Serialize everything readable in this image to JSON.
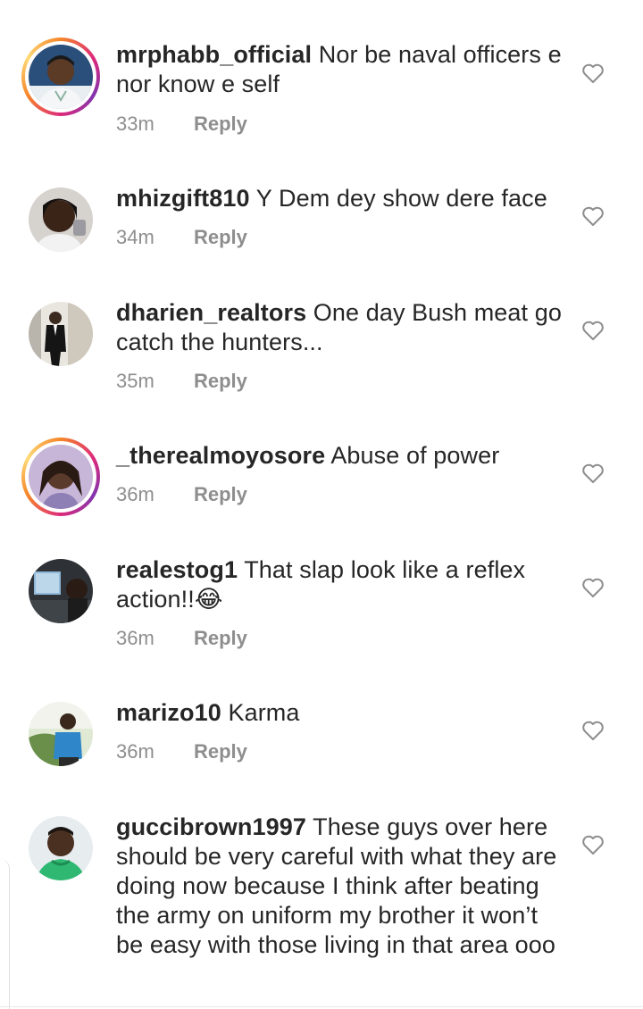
{
  "comments": [
    {
      "username": "mrphabb_official",
      "text": "Nor be naval officers e nor know e self",
      "time": "33m",
      "reply_label": "Reply",
      "avatar": "avatar-man-white-outfit",
      "has_story_ring": true
    },
    {
      "username": "mhizgift810",
      "text": "Y Dem dey show dere face",
      "time": "34m",
      "reply_label": "Reply",
      "avatar": "avatar-woman-selfie",
      "has_story_ring": false
    },
    {
      "username": "dharien_realtors",
      "text": "One day Bush meat go catch the hunters...",
      "time": "35m",
      "reply_label": "Reply",
      "avatar": "avatar-man-suit",
      "has_story_ring": false
    },
    {
      "username": "_therealmoyosore",
      "text": "Abuse of power",
      "time": "36m",
      "reply_label": "Reply",
      "avatar": "avatar-woman-braids",
      "has_story_ring": true
    },
    {
      "username": "realestog1",
      "text": "That slap look like a reflex action!!😂",
      "time": "36m",
      "reply_label": "Reply",
      "avatar": "avatar-man-room",
      "has_story_ring": false
    },
    {
      "username": "marizo10",
      "text": "Karma",
      "time": "36m",
      "reply_label": "Reply",
      "avatar": "avatar-man-outdoor",
      "has_story_ring": false
    },
    {
      "username": "guccibrown1997",
      "text": "These guys over here should be very careful with what they are doing now because I think after beating the army on uniform my brother it won’t be easy with those living in that area ooo",
      "time": "",
      "reply_label": "",
      "avatar": "avatar-man-green",
      "has_story_ring": false
    }
  ],
  "icons": {
    "like": "heart-outline-icon"
  },
  "colors": {
    "text": "#262626",
    "meta": "#8e8e8e",
    "story_ring_start": "#f58529",
    "story_ring_end": "#dd2a7b"
  }
}
